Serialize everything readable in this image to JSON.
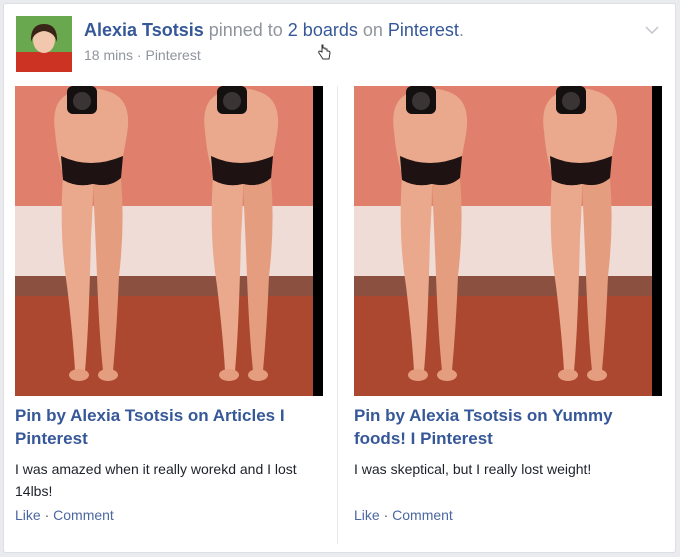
{
  "post": {
    "author": "Alexia Tsotsis",
    "action": " pinned to ",
    "boards": "2 boards",
    "on": " on ",
    "platform": "Pinterest",
    "period": ".",
    "time": "18 mins",
    "dot": " · ",
    "source": "Pinterest"
  },
  "pins": [
    {
      "title": "Pin by Alexia Tsotsis on Articles I Pinterest",
      "description": "I was amazed when it really worekd and I lost 14lbs!",
      "like": "Like",
      "comment": "Comment"
    },
    {
      "title": "Pin by Alexia Tsotsis on Yummy foods! I Pinterest",
      "description": "I was skeptical, but I really lost weight!",
      "like": "Like",
      "comment": "Comment"
    }
  ],
  "separator": " · ",
  "colors": {
    "link": "#365899",
    "meta": "#90949c",
    "text": "#1d2129",
    "border": "#dddfe2"
  },
  "icons": [
    "chevron-down-icon",
    "hand-cursor-icon"
  ]
}
